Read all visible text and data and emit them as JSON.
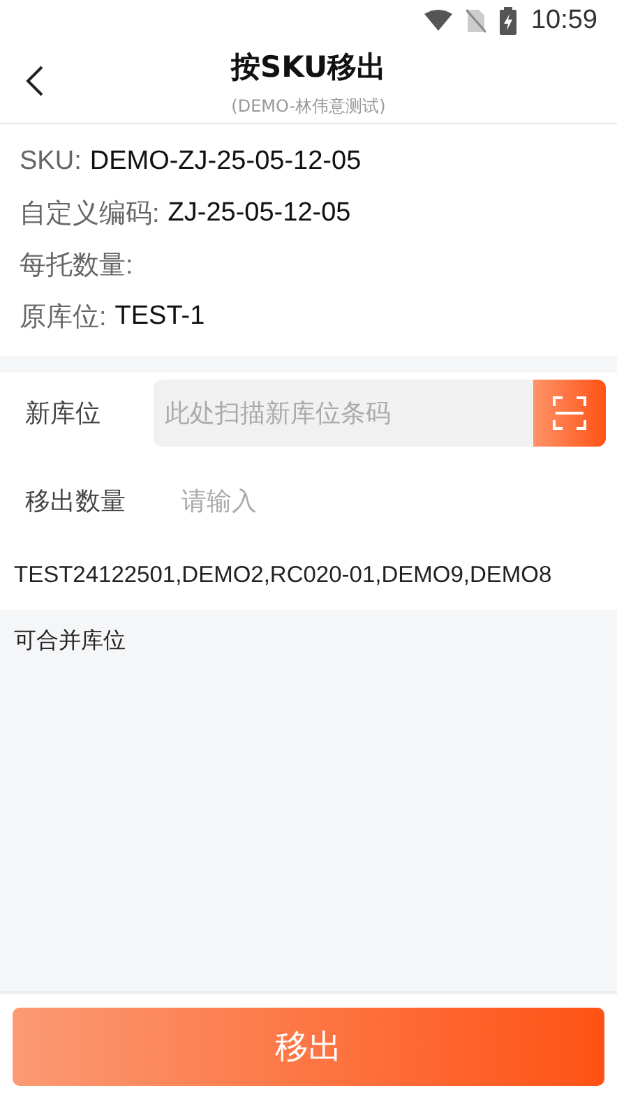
{
  "status_bar": {
    "time": "10:59"
  },
  "header": {
    "title": "按SKU移出",
    "subtitle": "(DEMO-林伟意测试)"
  },
  "info": [
    {
      "label": "SKU:",
      "value": "DEMO-ZJ-25-05-12-05"
    },
    {
      "label": "自定义编码:",
      "value": "ZJ-25-05-12-05"
    },
    {
      "label": "每托数量:"
    },
    {
      "label": "原库位:",
      "value": "TEST-1"
    }
  ],
  "new_location": {
    "label": "新库位",
    "placeholder": "此处扫描新库位条码"
  },
  "quantity": {
    "label": "移出数量",
    "placeholder": "请输入"
  },
  "locations": "TEST24122501,DEMO2,RC020-01,DEMO9,DEMO8",
  "mergeable": {
    "title": "可合并库位"
  },
  "submit": "移出"
}
